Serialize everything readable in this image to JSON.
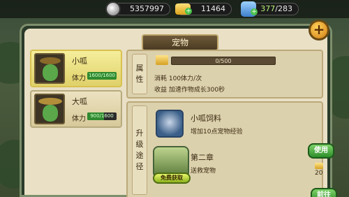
{
  "resources": {
    "silver": "5357997",
    "gold": "11464",
    "stamina_current": "377",
    "stamina_max": "/283"
  },
  "panel": {
    "title": "宠物"
  },
  "pets": [
    {
      "name": "小呱",
      "stamina_label": "体力",
      "stamina_text": "1600/1600",
      "stamina_ratio": 1.0
    },
    {
      "name": "大呱",
      "stamina_label": "体力",
      "stamina_text": "900/1600",
      "stamina_ratio": 0.5625
    }
  ],
  "attributes": {
    "section_label": [
      "属",
      "性"
    ],
    "exp_text": "0/500",
    "exp_ratio": 0,
    "consume": "消耗 100体力/次",
    "gain": "收益 加速作物成长300秒"
  },
  "upgrade": {
    "section_label": [
      "升",
      "级",
      "途",
      "径"
    ],
    "item1_name": "小呱饲料",
    "item1_desc": "增加10点宠物经验",
    "use_button": "使用",
    "item1_cost": "20",
    "item2_name": "第二章",
    "item2_desc": "送救宠物",
    "free_tag": "免费获取",
    "go_button": "前往"
  },
  "colors": {
    "accent": "#2d8e2a",
    "gold": "#d6a122"
  },
  "icons": [
    "silver-coin-icon",
    "gold-ingot-icon",
    "stamina-potion-icon",
    "add-icon",
    "food-icon"
  ]
}
